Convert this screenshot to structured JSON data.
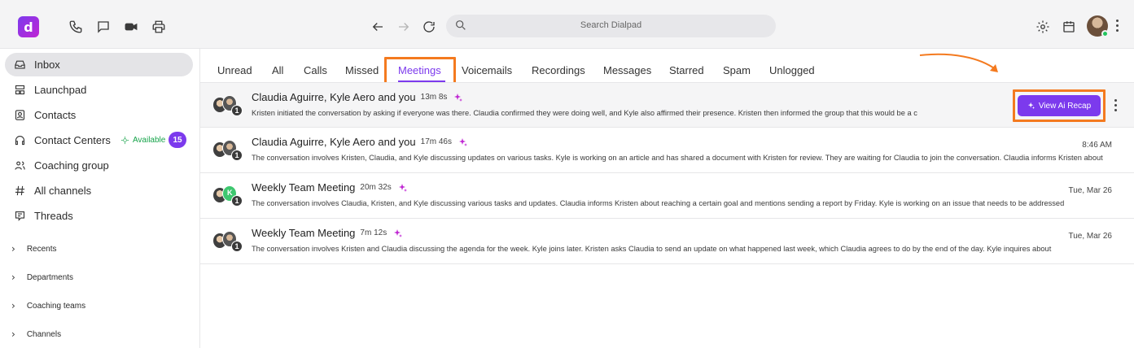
{
  "app": {
    "logo_letter": "d",
    "brand_color": "#7c3aed"
  },
  "topbar": {
    "icons": [
      "phone-icon",
      "chat-icon",
      "video-icon",
      "printer-icon",
      "back-arrow-icon",
      "forward-arrow-icon",
      "refresh-icon",
      "settings-icon",
      "calendar-icon"
    ],
    "search_placeholder": "Search Dialpad"
  },
  "sidebar": {
    "items": [
      {
        "label": "Inbox",
        "icon": "inbox-icon"
      },
      {
        "label": "Launchpad",
        "icon": "launchpad-icon"
      },
      {
        "label": "Contacts",
        "icon": "contacts-icon"
      },
      {
        "label": "Contact Centers",
        "icon": "headset-icon",
        "status": "Available",
        "count": "15"
      },
      {
        "label": "Coaching group",
        "icon": "group-icon"
      },
      {
        "label": "All channels",
        "icon": "hash-icon"
      },
      {
        "label": "Threads",
        "icon": "threads-icon"
      }
    ],
    "sections": [
      "Recents",
      "Departments",
      "Coaching teams",
      "Channels"
    ]
  },
  "tabs": [
    "Unread",
    "All",
    "Calls",
    "Missed",
    "Meetings",
    "Voicemails",
    "Recordings",
    "Messages",
    "Starred",
    "Spam",
    "Unlogged"
  ],
  "active_tab": "Meetings",
  "rows": [
    {
      "title": "Claudia Aguirre, Kyle Aero and you",
      "duration": "13m 8s",
      "description": "Kristen initiated the conversation by asking if everyone was there. Claudia confirmed they were doing well, and Kyle also affirmed their presence. Kristen then informed the group that this would be a c",
      "time": "",
      "participants_extra": "1"
    },
    {
      "title": "Claudia Aguirre, Kyle Aero and you",
      "duration": "17m 46s",
      "description": "The conversation involves Kristen, Claudia, and Kyle discussing updates on various tasks. Kyle is working on an article and has shared a document with Kristen for review. They are waiting for Claudia to join the conversation. Claudia informs Kristen about",
      "time": "8:46 AM",
      "participants_extra": "1"
    },
    {
      "title": "Weekly Team Meeting",
      "duration": "20m 32s",
      "description": "The conversation involves Claudia, Kristen, and Kyle discussing various tasks and updates. Claudia informs Kristen about reaching a certain goal and mentions sending a report by Friday. Kyle is working on an issue that needs to be addressed",
      "time": "Tue, Mar 26",
      "participants_extra": "1"
    },
    {
      "title": "Weekly Team Meeting",
      "duration": "7m 12s",
      "description": "The conversation involves Kristen and Claudia discussing the agenda for the week. Kyle joins later. Kristen asks Claudia to send an update on what happened last week, which Claudia agrees to do by the end of the day. Kyle inquires about",
      "time": "Tue, Mar 26",
      "participants_extra": "1"
    }
  ],
  "recap_button": "View Ai Recap",
  "highlight_color": "#f47a1f"
}
